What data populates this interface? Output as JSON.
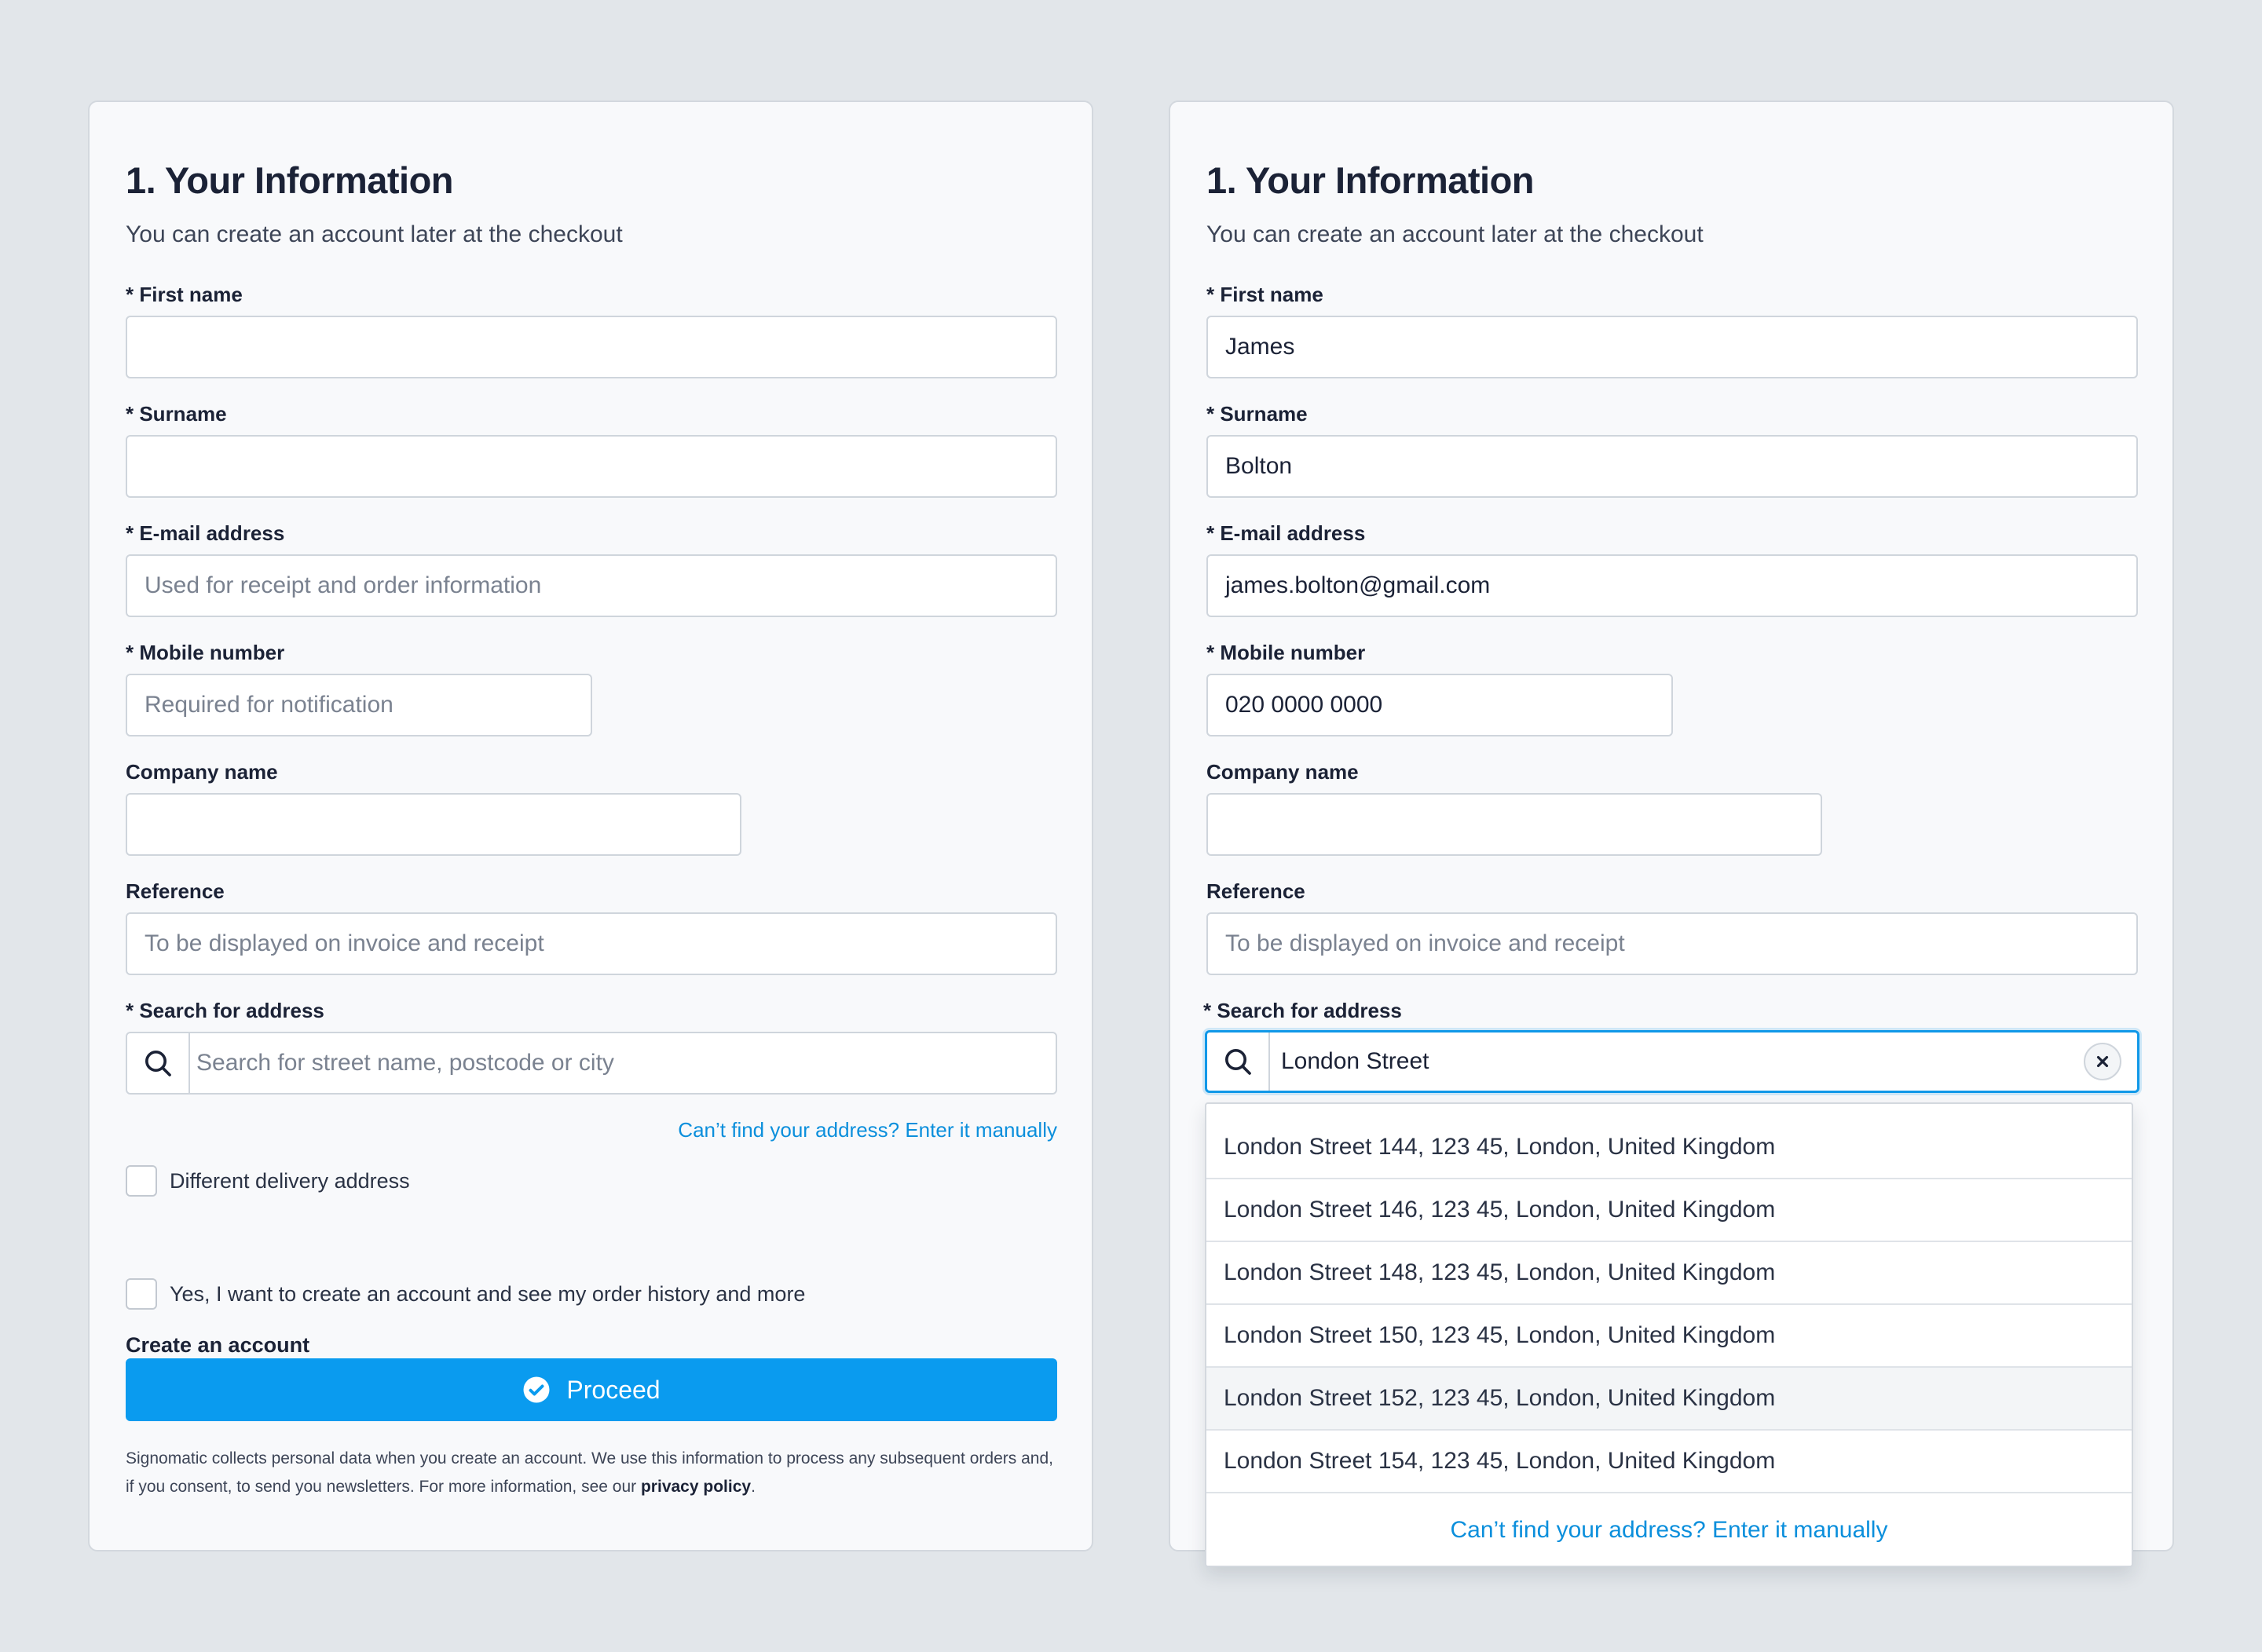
{
  "left": {
    "title": "1. Your Information",
    "subtitle": "You can create an account later at the checkout",
    "first_name": {
      "label": "* First name",
      "value": "",
      "placeholder": ""
    },
    "surname": {
      "label": "* Surname",
      "value": "",
      "placeholder": ""
    },
    "email": {
      "label": "* E-mail address",
      "placeholder": "Used for receipt and order information"
    },
    "mobile": {
      "label": "* Mobile number",
      "placeholder": "Required for notification"
    },
    "company": {
      "label": "Company name",
      "value": ""
    },
    "reference": {
      "label": "Reference",
      "placeholder": "To be displayed on invoice and receipt"
    },
    "address": {
      "label": "* Search for address",
      "placeholder": "Search for street name, postcode or city"
    },
    "manual_link": "Can’t find your address? Enter it manually",
    "delivery_checkbox": "Different delivery address",
    "account_heading": "Create an account",
    "account_checkbox": "Yes, I want to create an account and see my order history and more",
    "proceed_label": "Proceed",
    "disclaimer_text": "Signomatic collects personal data when you create an account. We use this information to process any subsequent orders and, if you consent, to send you newsletters. For more information, see our ",
    "privacy_link": "privacy policy",
    "disclaimer_end": "."
  },
  "right": {
    "title": "1. Your Information",
    "subtitle": "You can create an account later at the checkout",
    "first_name": {
      "label": "* First name",
      "value": "James"
    },
    "surname": {
      "label": "* Surname",
      "value": "Bolton"
    },
    "email": {
      "label": "* E-mail address",
      "value": "james.bolton@gmail.com"
    },
    "mobile": {
      "label": "* Mobile number",
      "value": "020 0000 0000"
    },
    "company": {
      "label": "Company name",
      "value": ""
    },
    "reference": {
      "label": "Reference",
      "placeholder": "To be displayed on invoice and receipt"
    },
    "address": {
      "label": "* Search for address",
      "value": "London Street"
    },
    "suggestions": [
      "London Street 144, 123 45, London, United Kingdom",
      "London Street 146, 123 45, London, United Kingdom",
      "London Street 148, 123 45, London, United Kingdom",
      "London Street 150, 123 45, London, United Kingdom",
      "London Street 152, 123 45, London, United Kingdom",
      "London Street 154, 123 45, London, United Kingdom"
    ],
    "dropdown_footer": "Can’t find your address? Enter it manually"
  },
  "colors": {
    "accent": "#0a9bef",
    "link": "#0b8fdc",
    "background": "#e2e6ea",
    "card": "#f8f9fb"
  }
}
